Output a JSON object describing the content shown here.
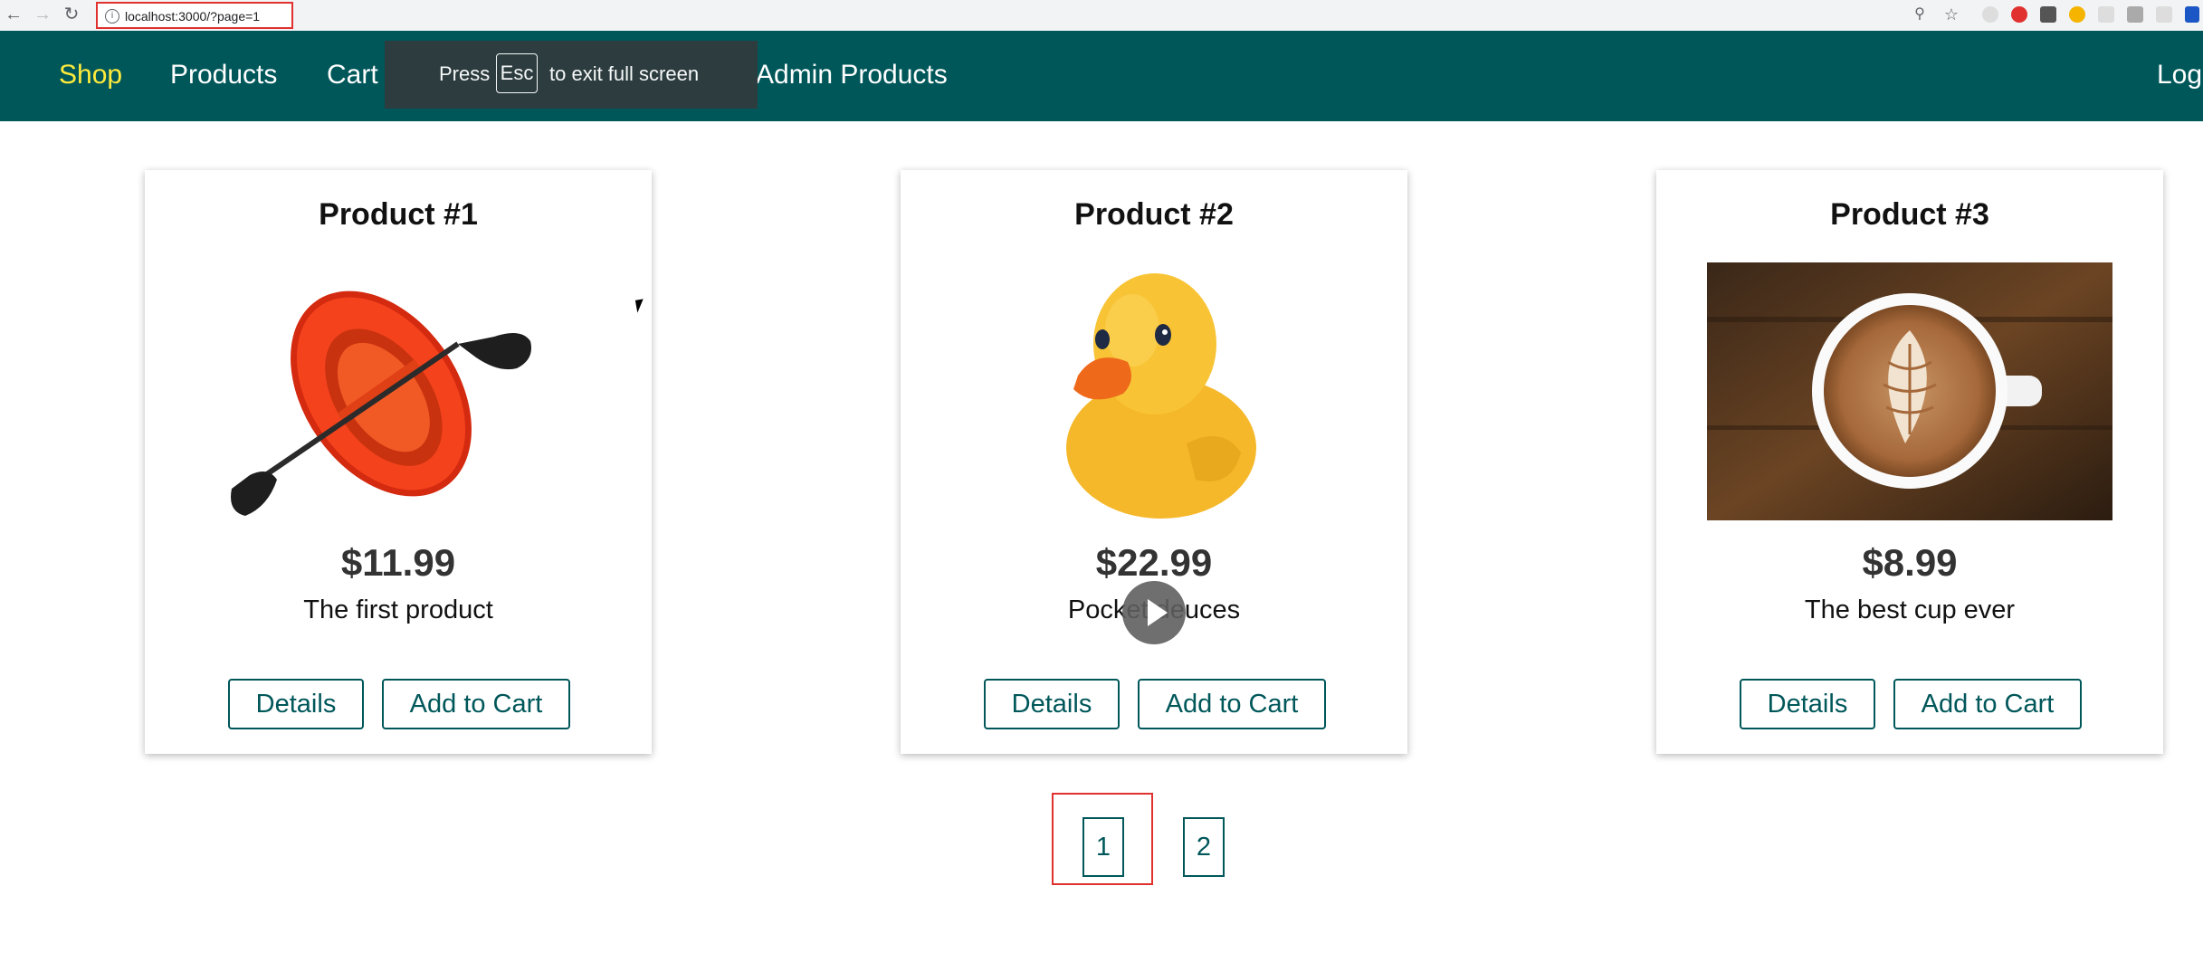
{
  "browser": {
    "url": "localhost:3000/?page=1"
  },
  "nav": {
    "shop": "Shop",
    "products": "Products",
    "cart": "Cart",
    "admin_products": "Admin Products",
    "logout_partial": "Logo"
  },
  "fullscreen_toast": {
    "prefix": "Press",
    "key": "Esc",
    "suffix": "to exit full screen"
  },
  "products": [
    {
      "title": "Product #1",
      "price": "$11.99",
      "description": "The first product",
      "image": "inflatable-boat",
      "details_label": "Details",
      "add_label": "Add to Cart"
    },
    {
      "title": "Product #2",
      "price": "$22.99",
      "description": "Pocket deuces",
      "image": "rubber-duck",
      "details_label": "Details",
      "add_label": "Add to Cart"
    },
    {
      "title": "Product #3",
      "price": "$8.99",
      "description": "The best cup ever",
      "image": "coffee-cup",
      "details_label": "Details",
      "add_label": "Add to Cart"
    }
  ],
  "pagination": {
    "pages": [
      "1",
      "2"
    ],
    "current": "1"
  },
  "colors": {
    "brand": "#00575a",
    "active_nav": "#ffeb3b",
    "highlight": "#e0312f"
  }
}
